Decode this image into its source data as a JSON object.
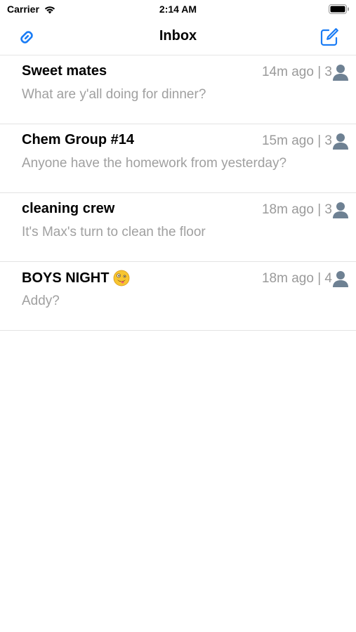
{
  "status_bar": {
    "carrier": "Carrier",
    "time": "2:14 AM"
  },
  "nav": {
    "title": "Inbox",
    "left_icon": "link-icon",
    "right_icon": "compose-icon",
    "accent_color": "#1a7cf5"
  },
  "threads": [
    {
      "title": "Sweet mates",
      "emoji": "",
      "time_ago": "14m ago",
      "separator": "|",
      "members": "3",
      "preview": "What are y'all doing for dinner?"
    },
    {
      "title": "Chem Group #14",
      "emoji": "",
      "time_ago": "15m ago",
      "separator": "|",
      "members": "3",
      "preview": "Anyone have the homework from yesterday?"
    },
    {
      "title": "cleaning crew",
      "emoji": "",
      "time_ago": "18m ago",
      "separator": "|",
      "members": "3",
      "preview": "It's Max's turn to clean the floor"
    },
    {
      "title": "BOYS NIGHT",
      "emoji": "zany-face-emoji",
      "time_ago": "18m ago",
      "separator": "|",
      "members": "4",
      "preview": "Addy?"
    }
  ]
}
